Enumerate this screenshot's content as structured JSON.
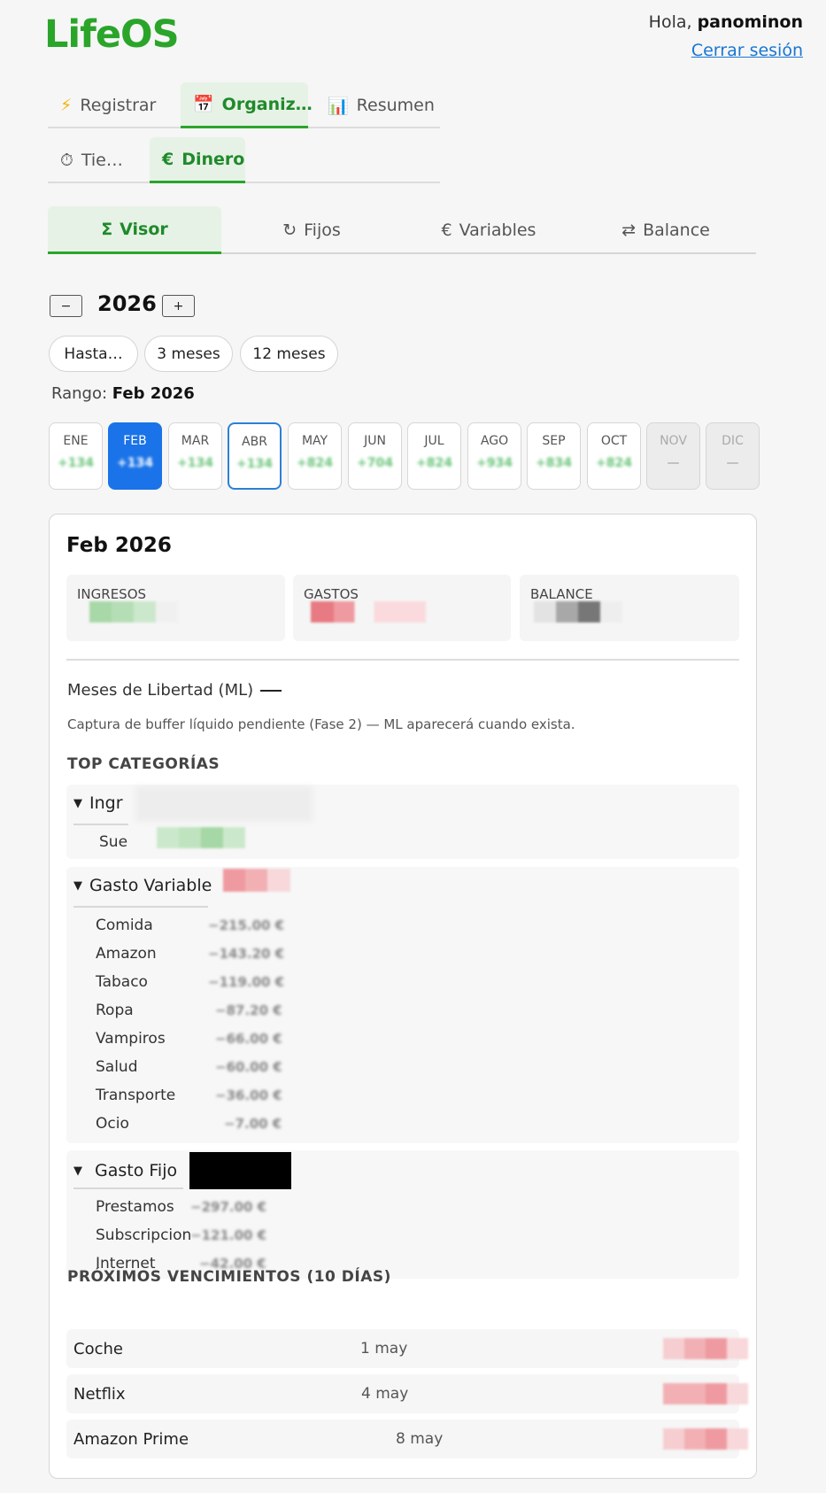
{
  "app": {
    "name": "LifeOS"
  },
  "user": {
    "greeting": "Hola,",
    "name": "panominon",
    "logout": "Cerrar sesión"
  },
  "main_tabs": [
    {
      "label": "Registrar",
      "icon": "lightning-icon",
      "glyph": "⚡"
    },
    {
      "label": "Organiz…",
      "icon": "calendar-icon",
      "glyph": "📅",
      "active": true
    },
    {
      "label": "Resumen",
      "icon": "bar-chart-icon",
      "glyph": "📊"
    }
  ],
  "second_tabs": [
    {
      "label": "Tie…",
      "icon": "stopwatch-icon",
      "glyph": "⏱"
    },
    {
      "label": "Dinero",
      "icon": "euro-icon",
      "glyph": "€",
      "active": true
    }
  ],
  "sub_tabs": [
    {
      "label": "Visor",
      "glyph": "Σ",
      "icon": "sigma-icon",
      "active": true
    },
    {
      "label": "Fijos",
      "glyph": "↻",
      "icon": "refresh-icon"
    },
    {
      "label": "Variables",
      "glyph": "€",
      "icon": "euro-icon"
    },
    {
      "label": "Balance",
      "glyph": "⇄",
      "icon": "swap-icon"
    }
  ],
  "year_selector": {
    "minus": "−",
    "year": "2026",
    "plus": "+"
  },
  "range_pills": [
    "Hasta…",
    "3 meses",
    "12 meses"
  ],
  "range": {
    "label": "Rango:",
    "value": "Feb 2026"
  },
  "months": [
    {
      "name": "ENE",
      "value": "+134"
    },
    {
      "name": "FEB",
      "value": "+134",
      "selected": true
    },
    {
      "name": "MAR",
      "value": "+134"
    },
    {
      "name": "ABR",
      "value": "+134",
      "current": true
    },
    {
      "name": "MAY",
      "value": "+824"
    },
    {
      "name": "JUN",
      "value": "+704"
    },
    {
      "name": "JUL",
      "value": "+824"
    },
    {
      "name": "AGO",
      "value": "+934"
    },
    {
      "name": "SEP",
      "value": "+834"
    },
    {
      "name": "OCT",
      "value": "+824"
    },
    {
      "name": "NOV",
      "value": "—",
      "disabled": true
    },
    {
      "name": "DIC",
      "value": "—",
      "disabled": true
    }
  ],
  "detail": {
    "title": "Feb 2026",
    "stats": [
      {
        "label": "INGRESOS"
      },
      {
        "label": "GASTOS"
      },
      {
        "label": "BALANCE"
      }
    ],
    "ml_label": "Meses de Libertad (ML)",
    "note": "Captura de buffer líquido pendiente (Fase 2) — ML aparecerá cuando exista.",
    "top_title": "TOP CATEGORÍAS",
    "groups": [
      {
        "name": "Ingr",
        "rows": [
          {
            "label": "Sue"
          }
        ]
      },
      {
        "name": "Gasto Variable",
        "rows": [
          {
            "label": "Comida",
            "value": "−215.00 €"
          },
          {
            "label": "Amazon",
            "value": "−143.20 €"
          },
          {
            "label": "Tabaco",
            "value": "−119.00 €"
          },
          {
            "label": "Ropa",
            "value": "−87.20 €"
          },
          {
            "label": "Vampiros",
            "value": "−66.00 €"
          },
          {
            "label": "Salud",
            "value": "−60.00 €"
          },
          {
            "label": "Transporte",
            "value": "−36.00 €"
          },
          {
            "label": "Ocio",
            "value": "−7.00 €"
          }
        ]
      },
      {
        "name": "Gasto Fijo",
        "rows": [
          {
            "label": "Prestamos",
            "value": "−297.00 €"
          },
          {
            "label": "Subscripcion",
            "value": "−121.00 €"
          },
          {
            "label": "Internet",
            "value": "−42.00 €"
          }
        ]
      }
    ],
    "due_title": "PRÓXIMOS VENCIMIENTOS (10 DÍAS)",
    "due": [
      {
        "name": "Coche",
        "date": "1 may"
      },
      {
        "name": "Netflix",
        "date": "4 may"
      },
      {
        "name": "Amazon Prime",
        "date": "8 may"
      }
    ]
  }
}
